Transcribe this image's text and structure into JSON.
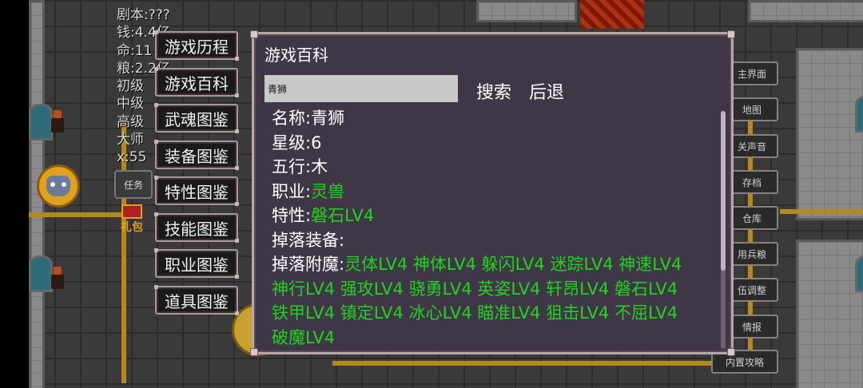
{
  "hud": {
    "lines": [
      "剧本:???",
      "钱:4.4亿",
      "命:11",
      "粮:2.2亿",
      "初级",
      "中级",
      "高级",
      "大师",
      "x:55"
    ],
    "task_label": "任务",
    "gift_label": "礼包"
  },
  "menu": {
    "items": [
      {
        "label": "游戏历程"
      },
      {
        "label": "游戏百科"
      },
      {
        "label": "武魂图鉴"
      },
      {
        "label": "装备图鉴"
      },
      {
        "label": "特性图鉴"
      },
      {
        "label": "技能图鉴"
      },
      {
        "label": "职业图鉴"
      },
      {
        "label": "道具图鉴"
      }
    ]
  },
  "side_buttons": [
    "主界面",
    "地图",
    "关声音",
    "存档",
    "仓库",
    "用兵粮",
    "伍调整",
    "情报",
    "内置攻略"
  ],
  "dialog": {
    "title": "游戏百科",
    "search": {
      "value": "青狮"
    },
    "search_label": "搜索",
    "back_label": "后退",
    "entry": {
      "name_label": "名称:",
      "name": "青狮",
      "star_label": "星级:",
      "star": "6",
      "element_label": "五行:",
      "element": "木",
      "class_label": "职业:",
      "class": "灵兽",
      "trait_label": "特性:",
      "trait": "磐石LV4",
      "drop_equip_label": "掉落装备:",
      "drop_equip": "",
      "drop_enchant_label": "掉落附魔:",
      "drop_enchant": "灵体LV4 神体LV4 躲闪LV4 迷踪LV4 神速LV4 神行LV4 强攻LV4 骁勇LV4 英姿LV4 轩昂LV4 磐石LV4 铁甲LV4 镇定LV4 冰心LV4 瞄准LV4 狙击LV4 不屈LV4 破魔LV4"
    }
  },
  "colors": {
    "value_green": "#22d322",
    "dialog_bg": "#3f3646"
  }
}
